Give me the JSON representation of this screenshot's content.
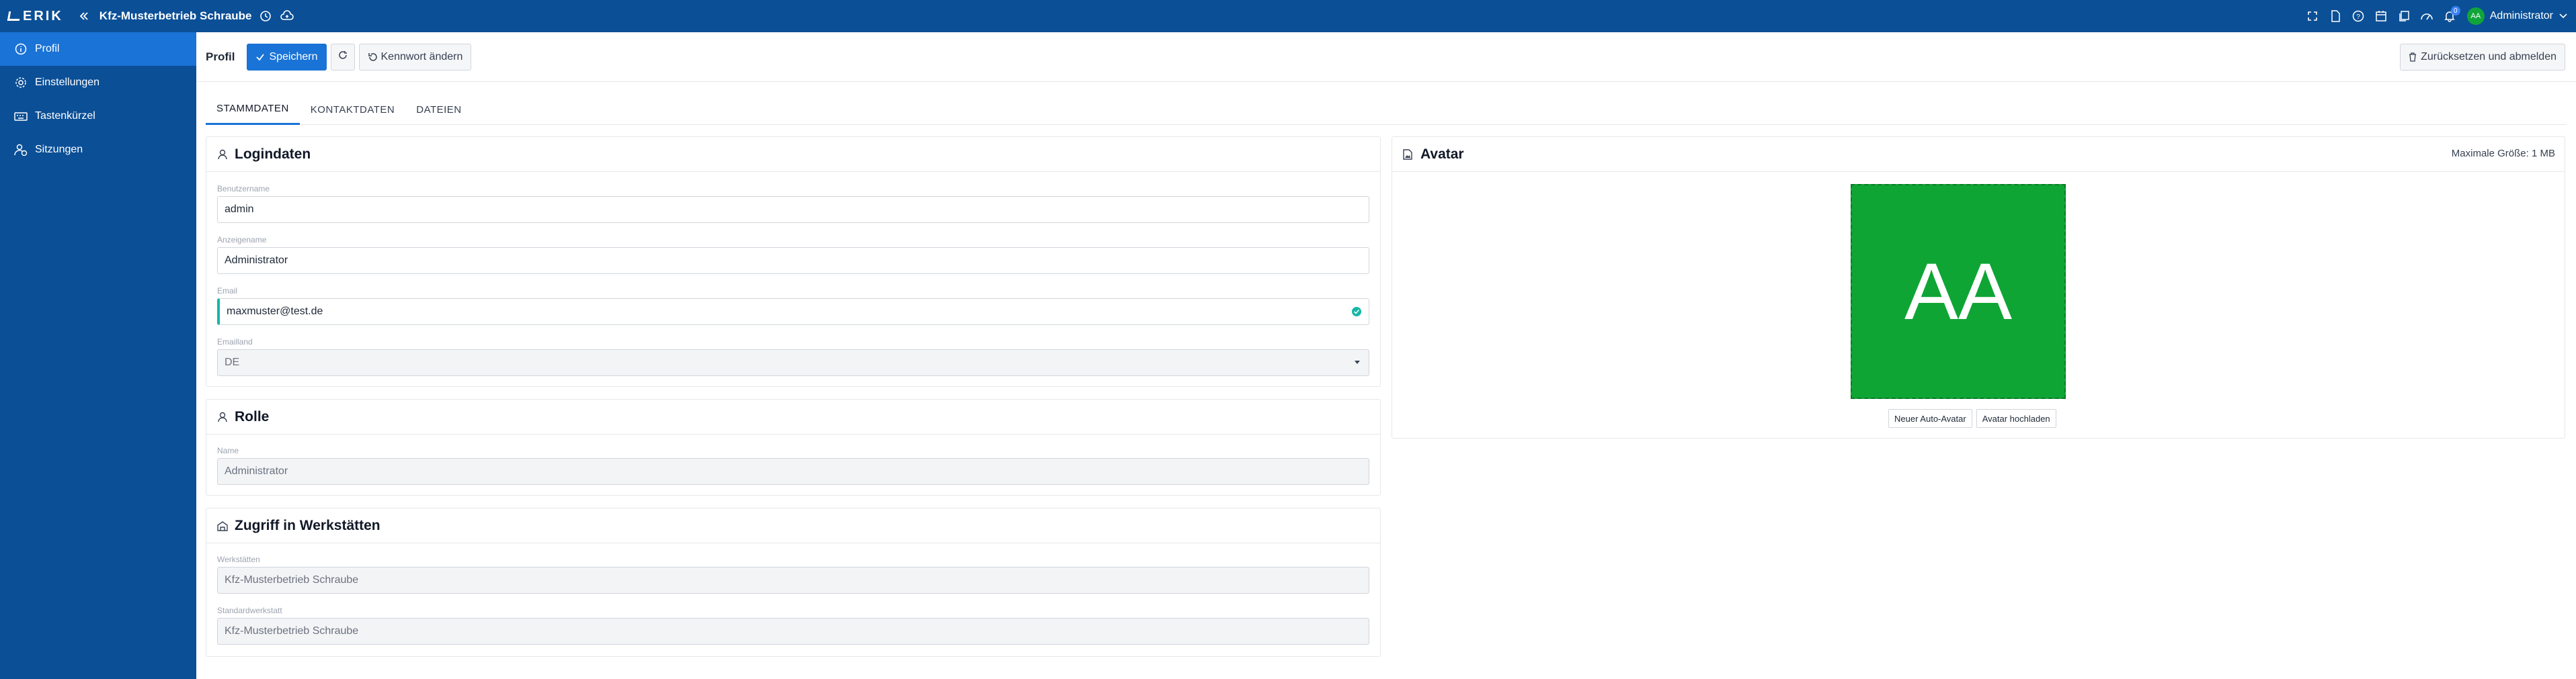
{
  "app": {
    "logo_text": "ERIK",
    "shop_name": "Kfz-Musterbetrieb Schraube",
    "user_initials": "AA",
    "user_name": "Administrator",
    "notification_count": "0",
    "accent_color": "#1a73d6",
    "topbar_color": "#0b4f96",
    "avatar_color": "#0fa535"
  },
  "sidebar": {
    "items": [
      {
        "label": "Profil",
        "icon": "info-icon"
      },
      {
        "label": "Einstellungen",
        "icon": "gear-icon"
      },
      {
        "label": "Tastenkürzel",
        "icon": "keyboard-icon"
      },
      {
        "label": "Sitzungen",
        "icon": "sessions-icon"
      }
    ]
  },
  "toolbar": {
    "page_label": "Profil",
    "save_label": "Speichern",
    "change_password_label": "Kennwort ändern",
    "reset_logout_label": "Zurücksetzen und abmelden"
  },
  "tabs": [
    "STAMMDATEN",
    "KONTAKTDATEN",
    "DATEIEN"
  ],
  "login": {
    "title": "Logindaten",
    "username_label": "Benutzername",
    "username_value": "admin",
    "display_label": "Anzeigename",
    "display_value": "Administrator",
    "email_label": "Email",
    "email_value": "maxmuster@test.de",
    "country_label": "Emailland",
    "country_value": "DE"
  },
  "role": {
    "title": "Rolle",
    "name_label": "Name",
    "name_value": "Administrator"
  },
  "workshops": {
    "title": "Zugriff in Werkstätten",
    "workshops_label": "Werkstätten",
    "workshops_value": "Kfz-Musterbetrieb Schraube",
    "default_label": "Standardwerkstatt",
    "default_value": "Kfz-Musterbetrieb Schraube"
  },
  "avatar": {
    "title": "Avatar",
    "max_size": "Maximale Größe: 1 MB",
    "initials": "AA",
    "new_auto_label": "Neuer Auto-Avatar",
    "upload_label": "Avatar hochladen"
  }
}
